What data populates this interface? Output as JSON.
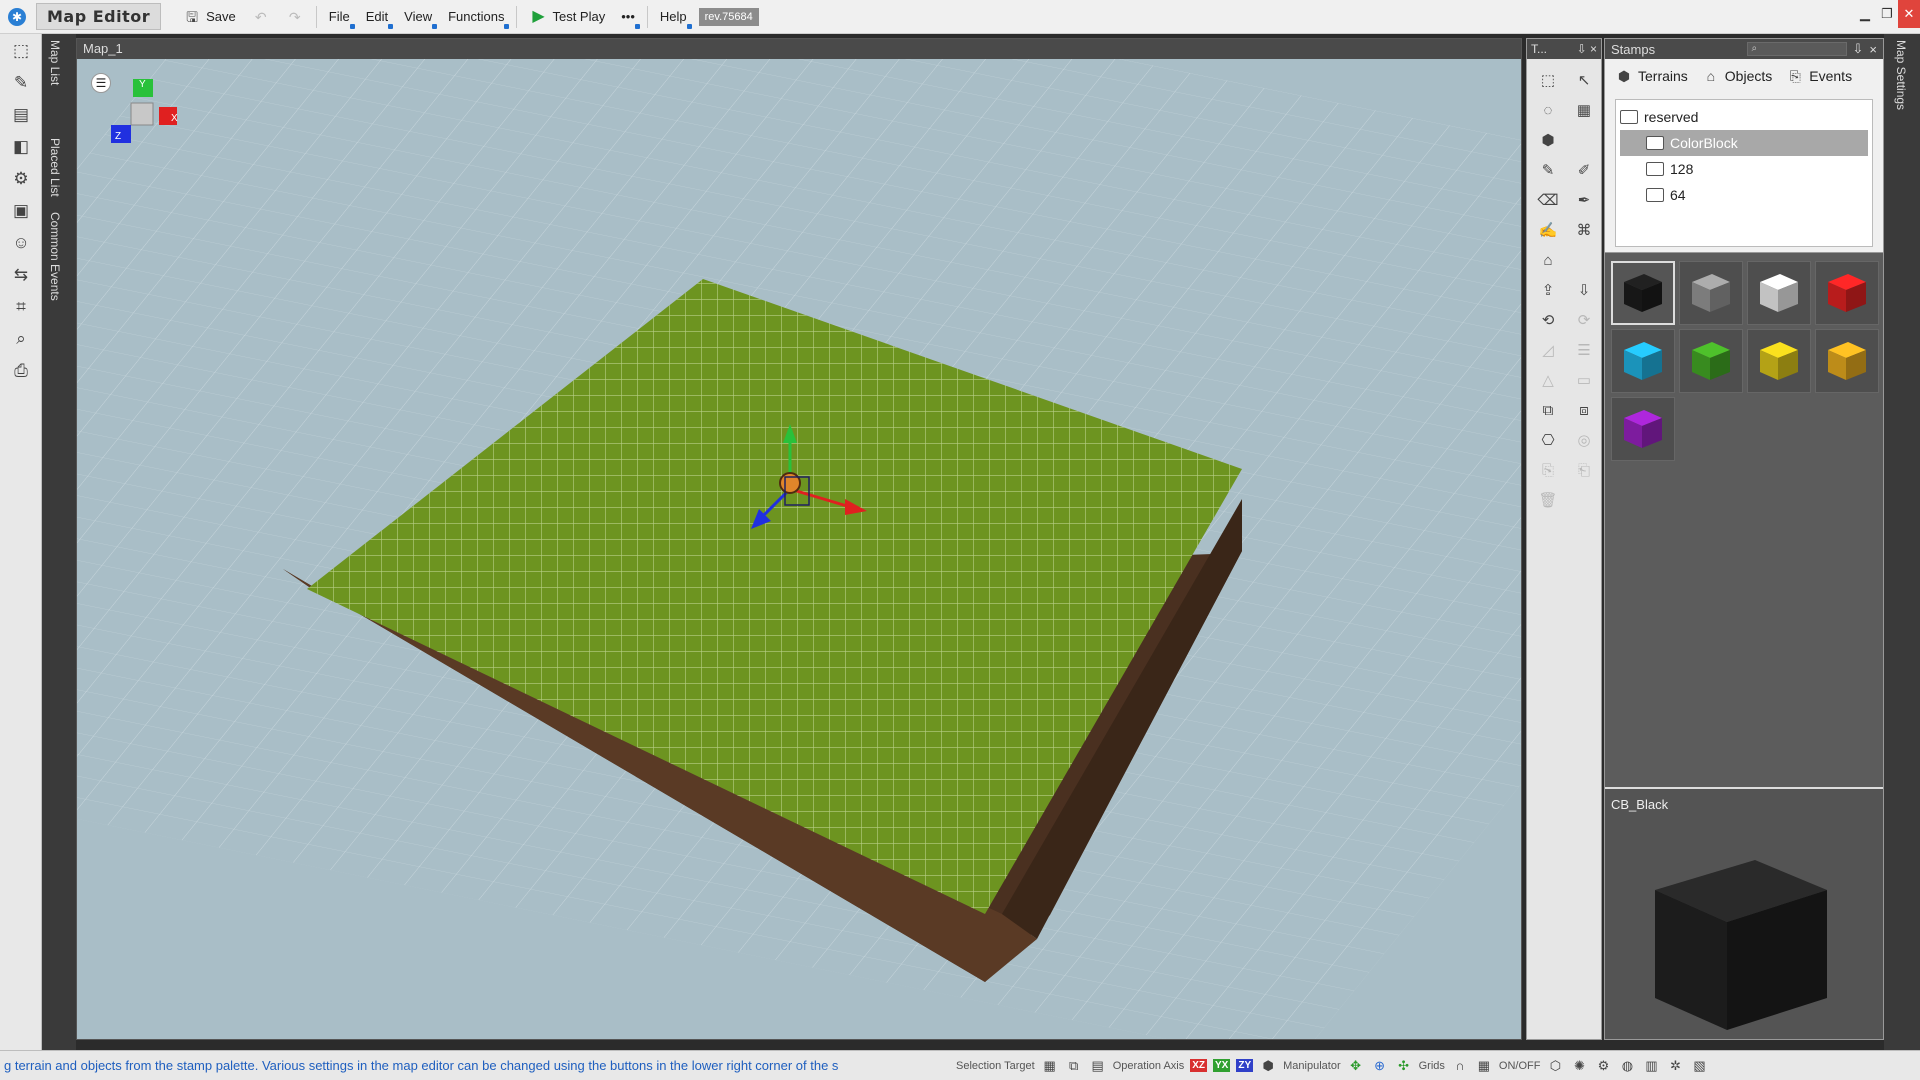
{
  "app": {
    "title": "Map Editor",
    "revision": "rev.75684"
  },
  "toolbar": {
    "save_label": "Save",
    "menus": [
      "File",
      "Edit",
      "View",
      "Functions"
    ],
    "test_play_label": "Test Play",
    "more_label": "•••",
    "help_label": "Help"
  },
  "left_tabs": [
    "Map List",
    "Placed List",
    "Common Events"
  ],
  "viewport": {
    "tab_title": "Map_1",
    "gizmo_axes": [
      "Y",
      "X",
      "Z"
    ]
  },
  "tools_panel": {
    "title": "T...",
    "pin_label": "⇩",
    "close_label": "×"
  },
  "stamps": {
    "title": "Stamps",
    "pin_label": "⇩",
    "close_label": "×",
    "tabs": [
      "Terrains",
      "Objects",
      "Events"
    ],
    "tree": {
      "root": "reserved",
      "items": [
        "ColorBlock",
        "128",
        "64"
      ]
    },
    "palette_colors": [
      "#1a1a1a",
      "#8a8a8a",
      "#d8d8d8",
      "#cc1f1f",
      "#1ea3cf",
      "#3e9a22",
      "#c8b418",
      "#d29b1c",
      "#8b1fb0"
    ],
    "preview_name": "CB_Black"
  },
  "right_strip_label": "Map Settings",
  "status": {
    "message": "g terrain and objects from the stamp palette.   Various settings in the map editor can be changed using the buttons in the lower right corner of the s",
    "selection_target_label": "Selection Target",
    "operation_axis_label": "Operation Axis",
    "axes": [
      "XZ",
      "YX",
      "ZY"
    ],
    "manipulator_label": "Manipulator",
    "grids_label": "Grids",
    "onoff_label": "ON/OFF"
  }
}
